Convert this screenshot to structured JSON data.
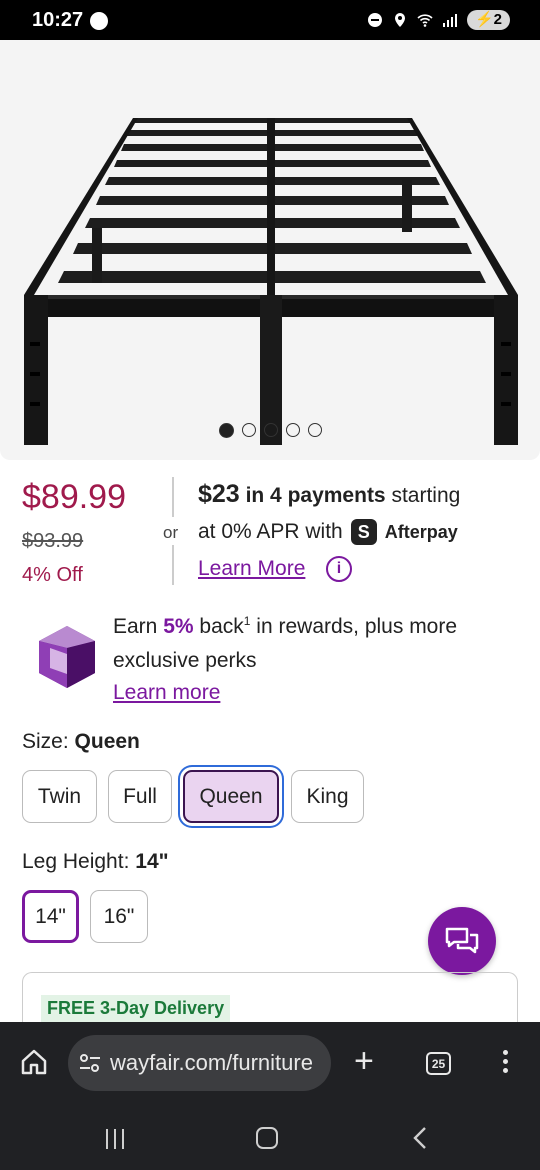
{
  "status_bar": {
    "time": "10:27",
    "messenger_icon": "messenger-icon",
    "battery": "2",
    "icons": [
      "dnd-icon",
      "location-icon",
      "wifi-icon",
      "signal-icon",
      "battery-icon"
    ]
  },
  "gallery": {
    "image_count": 5,
    "active_index": 0
  },
  "pricing": {
    "price": "$89.99",
    "original_price": "$93.99",
    "discount": "4% Off",
    "or_label": "or",
    "installment_amount": "$23",
    "installment_count_text": "in 4 payments",
    "installment_suffix": "starting",
    "apr_text": "at 0% APR with",
    "afterpay_badge": "S",
    "afterpay_name": "Afterpay",
    "learn_more": "Learn More",
    "info_icon": "i"
  },
  "rewards": {
    "earn_prefix": "Earn",
    "percent": "5%",
    "back_text": "back",
    "footnote": "1",
    "line1_suffix": "in rewards, plus more",
    "line2": "exclusive perks",
    "learn_more": "Learn more"
  },
  "size": {
    "label": "Size:",
    "selected": "Queen",
    "options": [
      "Twin",
      "Full",
      "Queen",
      "King"
    ]
  },
  "leg_height": {
    "label": "Leg Height:",
    "selected": "14\"",
    "options": [
      "14\"",
      "16\""
    ]
  },
  "delivery": {
    "badge": "FREE 3-Day Delivery"
  },
  "browser": {
    "url": "wayfair.com/furniture",
    "tab_count": "25"
  },
  "colors": {
    "accent_purple": "#7b189f",
    "price_red": "#a01a4c",
    "delivery_green": "#1b7a3a"
  }
}
